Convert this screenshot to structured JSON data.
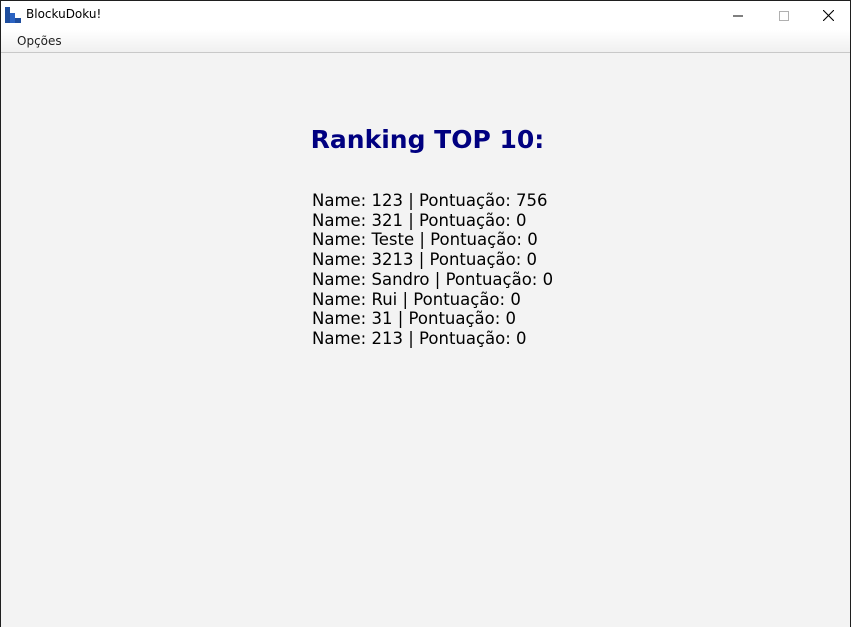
{
  "window": {
    "title": "BlockuDoku!",
    "icon": "app-blocks-icon",
    "controls": {
      "minimize": "minimize-icon",
      "maximize": "maximize-icon",
      "close": "close-icon"
    }
  },
  "menubar": {
    "items": [
      {
        "label": "Opções"
      }
    ]
  },
  "ranking": {
    "title": "Ranking TOP 10:",
    "title_color": "#000080",
    "entries": [
      "Name: 123 | Pontuação: 756",
      "Name: 321 | Pontuação: 0",
      "Name: Teste | Pontuação: 0",
      "Name: 3213 | Pontuação: 0",
      "Name: Sandro | Pontuação: 0",
      "Name: Rui | Pontuação: 0",
      "Name: 31 | Pontuação: 0",
      "Name: 213 | Pontuação: 0"
    ]
  }
}
